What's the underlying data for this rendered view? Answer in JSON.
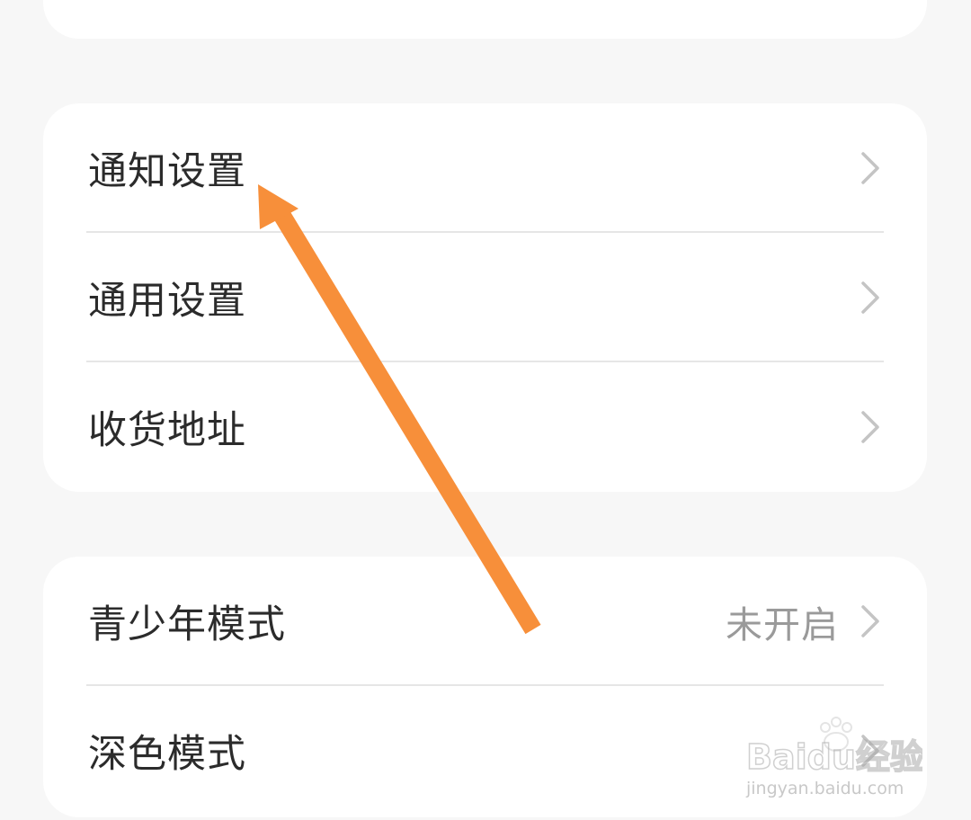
{
  "section_1": {
    "items": [
      {
        "label": "通知设置",
        "icon": "chevron-right-icon"
      },
      {
        "label": "通用设置",
        "icon": "chevron-right-icon"
      },
      {
        "label": "收货地址",
        "icon": "chevron-right-icon"
      }
    ]
  },
  "section_2": {
    "items": [
      {
        "label": "青少年模式",
        "value": "未开启",
        "icon": "chevron-right-icon"
      },
      {
        "label": "深色模式",
        "icon": "chevron-right-icon"
      }
    ]
  },
  "annotation": {
    "arrow_color": "#f78f3a",
    "arrow_icon": "arrow-up-left-icon"
  },
  "watermark": {
    "brand": "Baidu经验",
    "url": "jingyan.baidu.com"
  },
  "colors": {
    "background": "#f7f7f7",
    "card": "#ffffff",
    "label": "#2b2b2b",
    "secondary": "#9a9a9a",
    "divider": "#e6e6e6",
    "chevron": "#c4c4c4"
  }
}
